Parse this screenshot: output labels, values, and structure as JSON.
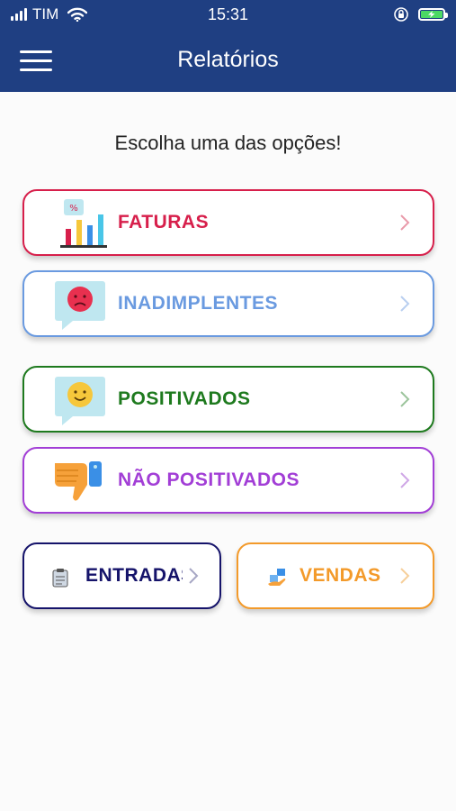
{
  "status_bar": {
    "carrier": "TIM",
    "time": "15:31",
    "icons": [
      "signal-icon",
      "wifi-icon",
      "orientation-lock-icon",
      "battery-charging-icon"
    ]
  },
  "header": {
    "title": "Relatórios",
    "menu_icon": "hamburger-menu-icon"
  },
  "prompt": "Escolha uma das opções!",
  "options": [
    {
      "label": "FATURAS",
      "color": "#d71f4b",
      "icon": "bar-chart-icon"
    },
    {
      "label": "INADIMPLENTES",
      "color": "#6a9ae0",
      "icon": "sad-face-chat-icon"
    },
    {
      "label": "POSITIVADOS",
      "color": "#1e7a1e",
      "icon": "smile-face-chat-icon"
    },
    {
      "label": "NÃO POSITIVADOS",
      "color": "#a23ed6",
      "icon": "thumbs-down-icon"
    },
    {
      "label": "ENTRADAS",
      "color": "#15136a",
      "icon": "clipboard-icon"
    },
    {
      "label": "VENDAS",
      "color": "#f39a2a",
      "icon": "hand-package-icon"
    }
  ],
  "colors": {
    "header_bg": "#1f3f82",
    "page_bg": "#fbfbfb"
  }
}
